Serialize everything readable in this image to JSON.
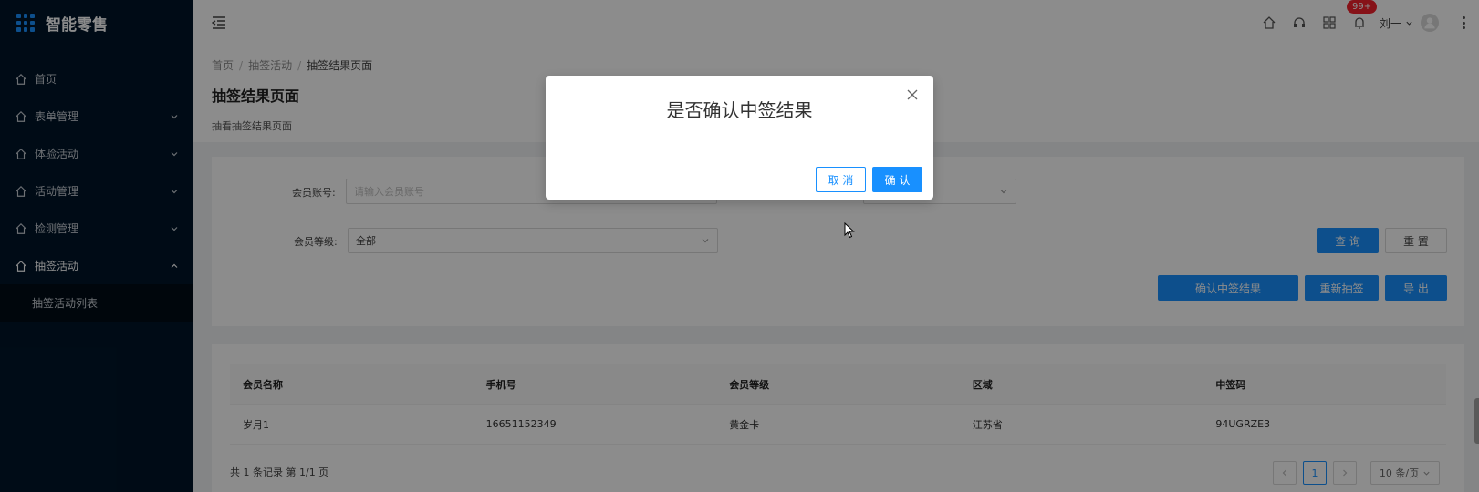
{
  "app": {
    "brand": "智能零售"
  },
  "sidebar": {
    "items": [
      {
        "label": "首页",
        "has_children": false
      },
      {
        "label": "表单管理",
        "has_children": true
      },
      {
        "label": "体验活动",
        "has_children": true
      },
      {
        "label": "活动管理",
        "has_children": true
      },
      {
        "label": "检测管理",
        "has_children": true
      },
      {
        "label": "抽签活动",
        "has_children": true,
        "expanded": true
      }
    ],
    "sub_items": [
      {
        "label": "抽签活动列表"
      }
    ]
  },
  "header": {
    "icons": [
      "home-icon",
      "headset-icon",
      "app-grid-icon",
      "bell-icon"
    ],
    "notification_badge": "99+",
    "user_name": "刘一"
  },
  "breadcrumb": {
    "items": [
      "首页",
      "抽签活动",
      "抽签结果页面"
    ]
  },
  "page": {
    "title": "抽签结果页面",
    "description": "抽看抽签结果页面"
  },
  "search": {
    "member_account_label": "会员账号:",
    "member_account_placeholder": "请输入会员账号",
    "member_level_label": "会员等级:",
    "member_level_value": "全部",
    "query_label": "查 询",
    "reset_label": "重 置",
    "confirm_result_label": "确认中签结果",
    "redraw_label": "重新抽签",
    "export_label": "导 出"
  },
  "table": {
    "columns": [
      "会员名称",
      "手机号",
      "会员等级",
      "区域",
      "中签码"
    ],
    "rows": [
      [
        "岁月1",
        "16651152349",
        "黄金卡",
        "江苏省",
        "94UGRZE3"
      ]
    ]
  },
  "pagination": {
    "summary": "共 1 条记录 第 1/1 页",
    "current_page": "1",
    "page_size": "10 条/页"
  },
  "modal": {
    "title": "是否确认中签结果",
    "cancel_label": "取 消",
    "confirm_label": "确 认"
  },
  "colors": {
    "sidebar_bg": "#001529",
    "primary": "#1890ff",
    "badge": "#f5222d"
  }
}
